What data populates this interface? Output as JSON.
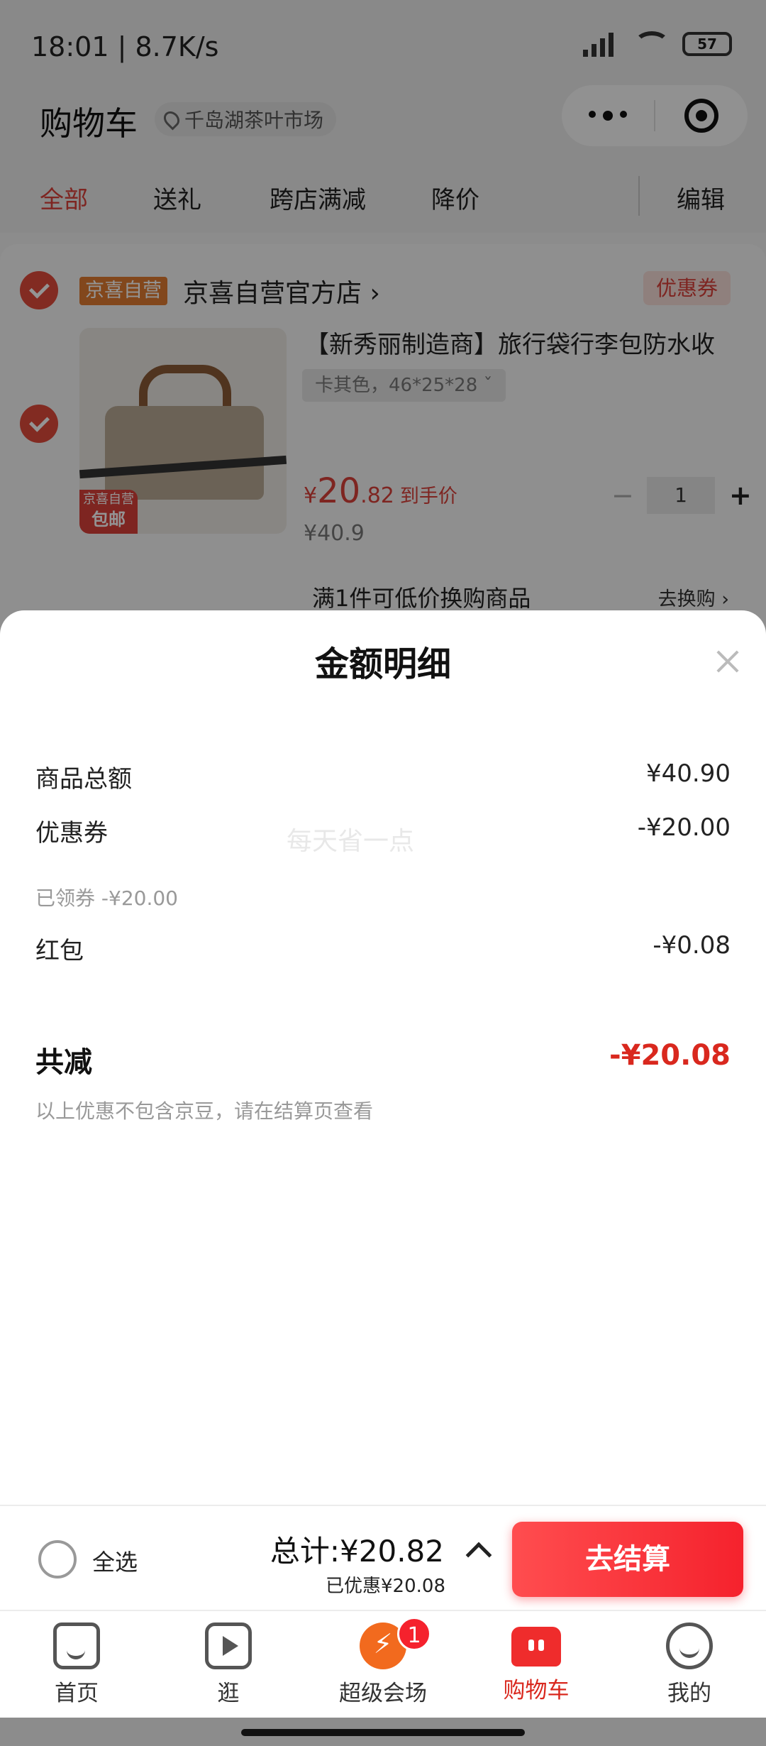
{
  "status_bar": {
    "time": "18:01 | 8.7K/s",
    "battery": "57"
  },
  "header": {
    "title": "购物车",
    "location": "千岛湖茶叶市场"
  },
  "filter_tabs": [
    {
      "label": "全部",
      "active": true
    },
    {
      "label": "送礼"
    },
    {
      "label": "跨店满减"
    },
    {
      "label": "降价"
    },
    {
      "label": "编辑"
    }
  ],
  "store": {
    "badge": "京喜自营",
    "name": "京喜自营官方店 ›",
    "coupon_tag": "优惠券",
    "product": {
      "title": "【新秀丽制造商】旅行袋行李包防水收",
      "spec": "卡其色，46*25*28  ˇ",
      "image_tag_top": "京喜自营",
      "image_tag_bottom": "包邮",
      "price_symbol": "¥",
      "price_int": "20",
      "price_dec": ".82",
      "price_label": "到手价",
      "original_price": "¥40.9",
      "qty": "1",
      "minus": "−",
      "plus": "+"
    },
    "swap_text": "满1件可低价换购商品",
    "swap_link": "去换购 ›"
  },
  "sheet": {
    "title": "金额明细",
    "watermark": "每天省一点",
    "rows": [
      {
        "label": "商品总额",
        "value": "¥40.90"
      },
      {
        "label": "优惠券",
        "value": "-¥20.00",
        "sub": "已领券 -¥20.00"
      },
      {
        "label": "红包",
        "value": "-¥0.08"
      }
    ],
    "total_label": "共减",
    "total_value": "-¥20.08",
    "note": "以上优惠不包含京豆，请在结算页查看"
  },
  "checkout": {
    "select_all": "全选",
    "total": "总计:¥20.82",
    "saved": "已优惠¥20.08",
    "pay_button": "去结算"
  },
  "nav": [
    {
      "label": "首页",
      "icon": "home-icon"
    },
    {
      "label": "逛",
      "icon": "play-icon"
    },
    {
      "label": "超级会场",
      "icon": "flash-icon",
      "badge": "1"
    },
    {
      "label": "购物车",
      "icon": "cart-icon",
      "active": true
    },
    {
      "label": "我的",
      "icon": "smile-icon"
    }
  ],
  "colors": {
    "accent": "#d9403a",
    "pay": "#f5222d"
  }
}
